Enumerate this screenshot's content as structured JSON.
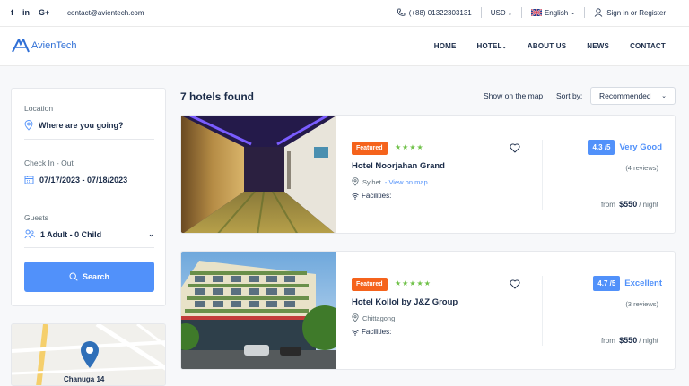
{
  "topbar": {
    "social": [
      "f",
      "in",
      "G+"
    ],
    "email": "contact@avientech.com",
    "phone": "(+88) 01322303131",
    "currency": "USD",
    "language": "English",
    "auth": "Sign in or Register"
  },
  "brand": {
    "name": "AvienTech"
  },
  "menu": [
    "HOME",
    "HOTEL",
    "ABOUT US",
    "NEWS",
    "CONTACT"
  ],
  "search": {
    "location_label": "Location",
    "location_value": "Where are you going?",
    "checkin_label": "Check In - Out",
    "checkin_value": "07/17/2023 - 07/18/2023",
    "guests_label": "Guests",
    "guests_value": "1 Adult - 0 Child",
    "button": "Search"
  },
  "map": {
    "label": "Chanuga 14"
  },
  "results": {
    "title": "7 hotels found",
    "show_map": "Show on the map",
    "sort_label": "Sort by:",
    "sort_value": "Recommended"
  },
  "hotels": [
    {
      "badge": "Featured",
      "stars": "★★★★",
      "name": "Hotel Noorjahan Grand",
      "city": "Sylhet",
      "map_link": "- View on map",
      "facilities": "Facilities:",
      "score": "4.3 /5",
      "score_word": "Very Good",
      "reviews": "(4 reviews)",
      "price_from": "from",
      "price": "$550",
      "price_unit": "/ night"
    },
    {
      "badge": "Featured",
      "stars": "★★★★★",
      "name": "Hotel Kollol by J&Z Group",
      "city": "Chittagong",
      "map_link": "",
      "facilities": "Facilities:",
      "score": "4.7 /5",
      "score_word": "Excellent",
      "reviews": "(3 reviews)",
      "price_from": "from",
      "price": "$550",
      "price_unit": "/ night"
    }
  ],
  "colors": {
    "accent": "#5191fa",
    "badge": "#f5631c",
    "stars": "#6fc148",
    "navy": "#1a2b48"
  }
}
